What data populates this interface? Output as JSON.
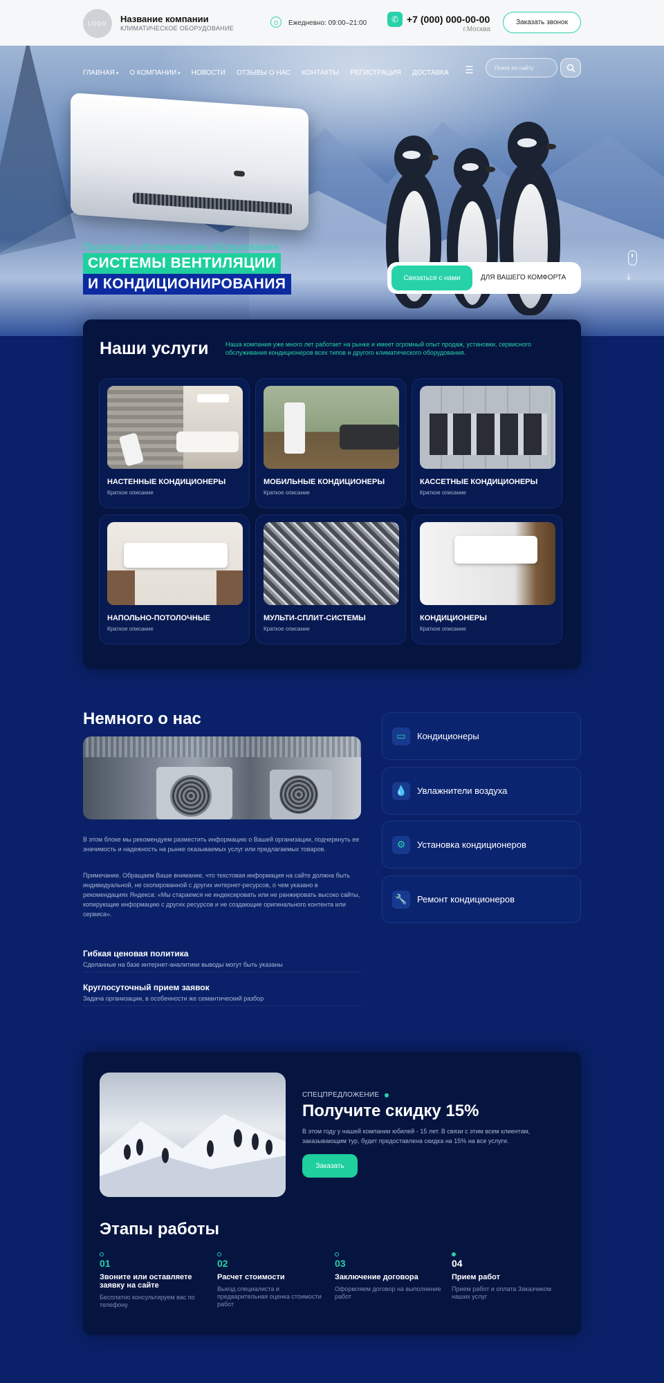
{
  "header": {
    "logo_text": "LOGO",
    "company_name": "Название компании",
    "company_sub": "КЛИМАТИЧЕСКОЕ ОБОРУДОВАНИЕ",
    "hours": "Ежедневно: 09:00–21:00",
    "phone": "+7 (000) 000-00-00",
    "city": "г.Москва",
    "callback_label": "Заказать звонок"
  },
  "nav": {
    "items": [
      "ГЛАВНАЯ",
      "О КОМПАНИИ",
      "НОВОСТИ",
      "ОТЗЫВЫ О НАС",
      "КОНТАКТЫ",
      "РЕГИСТРАЦИЯ",
      "ДОСТАВКА"
    ],
    "search_placeholder": "Поиск по сайту"
  },
  "hero": {
    "kicker": "Продажа и обслуживание оборудования",
    "line1": "СИСТЕМЫ ВЕНТИЛЯЦИИ",
    "line2": "И КОНДИЦИОНИРОВАНИЯ",
    "cta_button": "Связаться с нами",
    "cta_text": "ДЛЯ ВАШЕГО КОМФОРТА"
  },
  "services": {
    "title": "Наши услуги",
    "description": "Наша компания уже много лет работает на рынке и имеет огромный опыт продаж, установки, сервисного обслуживания кондиционеров всех типов и другого климатического оборудования.",
    "cards": [
      {
        "title": "НАСТЕННЫЕ КОНДИЦИОНЕРЫ",
        "subtitle": "Краткое описание"
      },
      {
        "title": "МОБИЛЬНЫЕ КОНДИЦИОНЕРЫ",
        "subtitle": "Краткое описание"
      },
      {
        "title": "КАССЕТНЫЕ КОНДИЦИОНЕРЫ",
        "subtitle": "Краткое описание"
      },
      {
        "title": "НАПОЛЬНО-ПОТОЛОЧНЫЕ",
        "subtitle": "Краткое описание"
      },
      {
        "title": "МУЛЬТИ-СПЛИТ-СИСТЕМЫ",
        "subtitle": "Краткое описание"
      },
      {
        "title": "КОНДИЦИОНЕРЫ",
        "subtitle": "Краткое описание"
      }
    ]
  },
  "about": {
    "title": "Немного о нас",
    "p1": "В этом блоке мы рекомендуем разместить информацию о Вашей организации, подчеркнуть ее значимость и надежность на рынке оказываемых услуг или предлагаемых товаров.",
    "p2": "Примечание. Обращаем Ваше внимание, что текстовая информация на сайте должна быть индивидуальной, не скопированной с других интернет-ресурсов, о чем указано в рекомендациях Яндекса: «Мы стараемся не индексировать или не ранжировать высоко сайты, копирующие информацию с других ресурсов и не создающие оригинального контента или сервиса».",
    "features": [
      {
        "title": "Гибкая ценовая политика",
        "subtitle": "Сделанные на базе интернет-аналитики выводы могут быть указаны"
      },
      {
        "title": "Круглосуточный прием заявок",
        "subtitle": "Задача организации, в особенности же семантический разбор"
      }
    ],
    "categories": [
      "Кондиционеры",
      "Увлажнители воздуха",
      "Установка кондиционеров",
      "Ремонт кондиционеров"
    ]
  },
  "promo": {
    "kicker": "СПЕЦПРЕДЛОЖЕНИЕ",
    "title": "Получите скидку 15%",
    "text": "В этом году у нашей компании юбилей - 15 лет. В связи с этим всем клиентам, заказывающим тур, будет предоставлена скидка на 15% на все услуги.",
    "button": "Заказать"
  },
  "steps": {
    "title": "Этапы работы",
    "items": [
      {
        "num": "01",
        "title": "Звоните или оставляете заявку на сайте",
        "subtitle": "Бесплатно консультируем вас по телефону"
      },
      {
        "num": "02",
        "title": "Расчет стоимости",
        "subtitle": "Выезд специалиста и предварительная оценка стоимости работ"
      },
      {
        "num": "03",
        "title": "Заключение договора",
        "subtitle": "Оформляем договор на выполнение работ"
      },
      {
        "num": "04",
        "title": "Прием работ",
        "subtitle": "Прием работ и оплата Заказчиком наших услуг"
      }
    ]
  },
  "colors": {
    "accent": "#27d2a9",
    "brand_blue": "#0d2ba1",
    "page_bg": "#0a2169",
    "panel_bg": "#061440"
  }
}
